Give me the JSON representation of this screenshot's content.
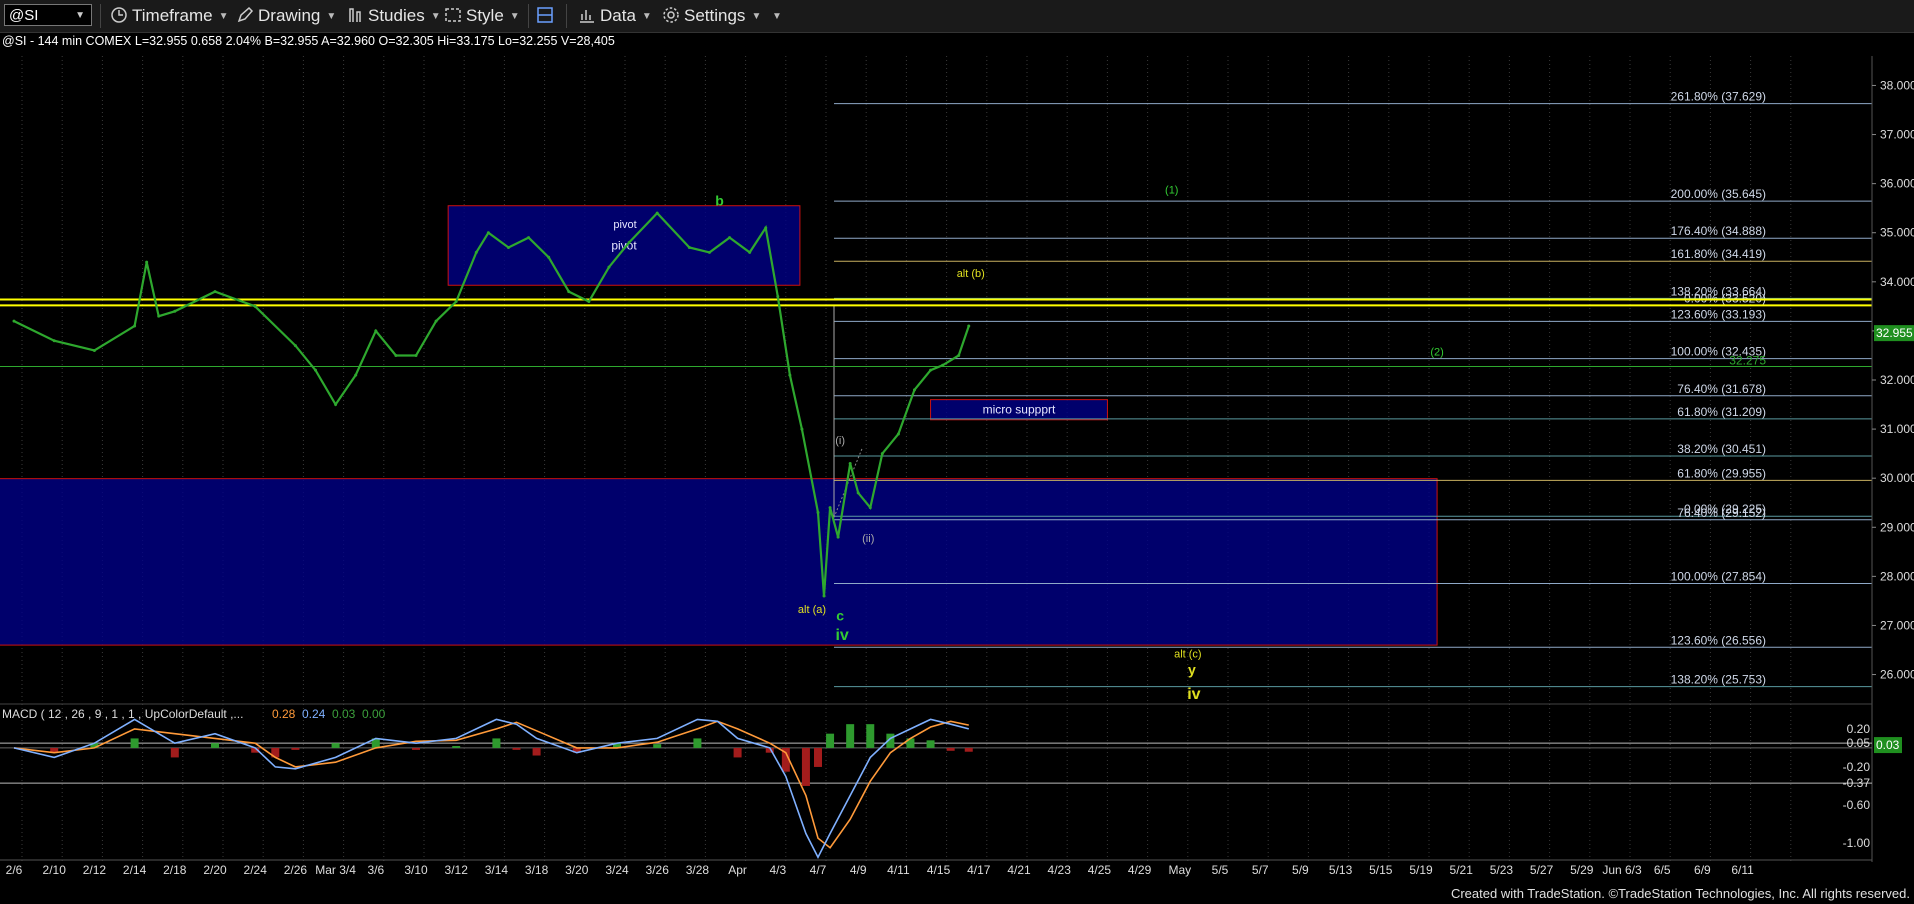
{
  "toolbar": {
    "symbol": "@SI",
    "timeframe": "Timeframe",
    "drawing": "Drawing",
    "studies": "Studies",
    "style": "Style",
    "data": "Data",
    "settings": "Settings"
  },
  "info_line": "@SI - 144 min  COMEX  L=32.955  0.658  2.04%  B=32.955  A=32.960  O=32.305  Hi=33.175  Lo=32.255  V=28,405",
  "footer": "Created with TradeStation. ©TradeStation Technologies, Inc. All rights reserved.",
  "colors": {
    "background": "#000000",
    "price": "#2ea82e",
    "box_fill": "#00008b",
    "box_border": "#cc1111",
    "yellow_line": "#ffff00",
    "wave_green": "#33cc33",
    "wave_yellow": "#e0e020",
    "macd_line": "#7fb0ff",
    "signal_line": "#ff9a3a"
  },
  "chart_data": {
    "type": "line",
    "x_ticks": [
      "2/6",
      "2/10",
      "2/12",
      "2/14",
      "2/18",
      "2/20",
      "2/24",
      "2/26",
      "Mar 3/4",
      "3/6",
      "3/10",
      "3/12",
      "3/14",
      "3/18",
      "3/20",
      "3/24",
      "3/26",
      "3/28",
      "Apr",
      "4/3",
      "4/7",
      "4/9",
      "4/11",
      "4/15",
      "4/17",
      "4/21",
      "4/23",
      "4/25",
      "4/29",
      "May",
      "5/5",
      "5/7",
      "5/9",
      "5/13",
      "5/15",
      "5/19",
      "5/21",
      "5/23",
      "5/27",
      "5/29",
      "Jun 6/3",
      "6/5",
      "6/9",
      "6/11"
    ],
    "y_ticks": [
      26,
      27,
      28,
      29,
      30,
      31,
      32,
      33,
      34,
      35,
      36,
      37,
      38
    ],
    "y_tick_labels": [
      "26.000",
      "27.000",
      "28.000",
      "29.000",
      "30.000",
      "31.000",
      "32.000",
      "33.000",
      "34.000",
      "35.000",
      "36.000",
      "37.000",
      "38.000"
    ],
    "ylim": [
      25.4,
      38.6
    ],
    "last_price": 32.955,
    "last_price_label": "32.955",
    "price_series": {
      "x": [
        0,
        1,
        2,
        3,
        3.3,
        3.6,
        4,
        5,
        6,
        7,
        7.5,
        8,
        8.5,
        9,
        9.5,
        10,
        10.5,
        11,
        11.5,
        11.8,
        12.3,
        12.8,
        13.3,
        13.8,
        14.3,
        14.8,
        15.3,
        16,
        16.8,
        17.3,
        17.8,
        18.3,
        18.7,
        19,
        19.3,
        19.6,
        20,
        20.15,
        20.3,
        20.5,
        20.8,
        21,
        21.3,
        21.6,
        22,
        22.4,
        22.8,
        23.1,
        23.5,
        23.75
      ],
      "y": [
        33.2,
        32.8,
        32.6,
        33.1,
        34.4,
        33.3,
        33.4,
        33.8,
        33.5,
        32.7,
        32.2,
        31.5,
        32.1,
        33.0,
        32.5,
        32.5,
        33.2,
        33.6,
        34.6,
        35.0,
        34.7,
        34.9,
        34.5,
        33.8,
        33.6,
        34.3,
        34.8,
        35.4,
        34.7,
        34.6,
        34.9,
        34.6,
        35.1,
        33.7,
        32.1,
        31.0,
        29.3,
        27.6,
        29.4,
        28.8,
        30.3,
        29.7,
        29.4,
        30.5,
        30.9,
        31.8,
        32.2,
        32.3,
        32.5,
        33.1
      ]
    },
    "boxes": [
      {
        "label": "pivot",
        "x0": 10.8,
        "x1": 19.55,
        "y0": 33.93,
        "y1": 35.55
      },
      {
        "label": "micro suppprt",
        "x0": 22.8,
        "x1": 27.2,
        "y0": 31.19,
        "y1": 31.6
      },
      {
        "label": "",
        "x0": -0.5,
        "x1": 35.4,
        "y0": 26.6,
        "y1": 29.99
      }
    ],
    "yellow_levels": [
      33.64,
      33.52
    ],
    "fib_levels": [
      {
        "label": "261.80% (37.629)",
        "value": 37.629,
        "color": "#8fa9c8"
      },
      {
        "label": "200.00% (35.645)",
        "value": 35.645,
        "color": "#8fa9c8"
      },
      {
        "label": "176.40% (34.888)",
        "value": 34.888,
        "color": "#8fa9c8"
      },
      {
        "label": "161.80% (34.419)",
        "value": 34.419,
        "color": "#c8b060"
      },
      {
        "label": "138.20% (33.664)",
        "value": 33.664,
        "color": "#5a9aa0"
      },
      {
        "label": "0.00% (33.520)",
        "value": 33.52,
        "color": "#5a9aa0"
      },
      {
        "label": "123.60% (33.193)",
        "value": 33.193,
        "color": "#8fa9c8"
      },
      {
        "label": "100.00% (32.435)",
        "value": 32.435,
        "color": "#8fa9c8"
      },
      {
        "label": "76.40% (31.678)",
        "value": 31.678,
        "color": "#8fa9c8"
      },
      {
        "label": "61.80% (31.209)",
        "value": 31.209,
        "color": "#5a9aa0"
      },
      {
        "label": "38.20% (30.451)",
        "value": 30.451,
        "color": "#5a9aa0"
      },
      {
        "label": "61.80% (29.955)",
        "value": 29.955,
        "color": "#c8b060"
      },
      {
        "label": "0.00% (29.225)",
        "value": 29.225,
        "color": "#5a9aa0"
      },
      {
        "label": "76.40% (29.152)",
        "value": 29.152,
        "color": "#8fa9c8"
      },
      {
        "label": "100.00% (27.854)",
        "value": 27.854,
        "color": "#8fa9c8"
      },
      {
        "label": "123.60% (26.556)",
        "value": 26.556,
        "color": "#8fa9c8"
      },
      {
        "label": "138.20% (25.753)",
        "value": 25.753,
        "color": "#5a9aa0"
      }
    ],
    "green_levels": [
      {
        "label": "32.275",
        "value": 32.275
      }
    ],
    "annotations": [
      {
        "text": "b",
        "x": 17.55,
        "y": 35.55,
        "color": "#33cc33",
        "size": 14
      },
      {
        "text": "pivot",
        "x": 15.2,
        "y": 35.1,
        "color": "#e6e6ff",
        "size": 11
      },
      {
        "text": "alt (b)",
        "x": 23.8,
        "y": 34.1,
        "color": "#e0e020",
        "size": 11
      },
      {
        "text": "(1)",
        "x": 28.8,
        "y": 35.8,
        "color": "#33cc33",
        "size": 11
      },
      {
        "text": "(2)",
        "x": 35.4,
        "y": 32.5,
        "color": "#33cc33",
        "size": 11
      },
      {
        "text": "(i)",
        "x": 20.55,
        "y": 30.7,
        "color": "#aaaaaa",
        "size": 11
      },
      {
        "text": "(ii)",
        "x": 21.25,
        "y": 28.7,
        "color": "#aaaaaa",
        "size": 11
      },
      {
        "text": "alt (a)",
        "x": 19.85,
        "y": 27.25,
        "color": "#e0e020",
        "size": 11
      },
      {
        "text": "c",
        "x": 20.55,
        "y": 27.1,
        "color": "#33cc33",
        "size": 14
      },
      {
        "text": "iv",
        "x": 20.6,
        "y": 26.7,
        "color": "#33cc33",
        "size": 16
      },
      {
        "text": "alt (c)",
        "x": 29.2,
        "y": 26.35,
        "color": "#e0e020",
        "size": 11
      },
      {
        "text": "y",
        "x": 29.3,
        "y": 26.0,
        "color": "#e0e020",
        "size": 14
      },
      {
        "text": "iv",
        "x": 29.35,
        "y": 25.5,
        "color": "#e0e020",
        "size": 16
      }
    ],
    "macd": {
      "title": "MACD ( 12 , 26 , 9 , 1 , 1 , UpColorDefault ,...",
      "values": [
        "0.28",
        "0.24",
        "0.03",
        "0.00"
      ],
      "ylim": [
        -1.2,
        0.42
      ],
      "y_tick_labels": [
        {
          "label": "0.20",
          "value": 0.2
        },
        {
          "label": "0.05",
          "value": 0.05
        },
        {
          "label": "-0.20",
          "value": -0.2
        },
        {
          "label": "-0.37",
          "value": -0.37
        },
        {
          "label": "-0.60",
          "value": -0.6
        },
        {
          "label": "-1.00",
          "value": -1.0
        }
      ],
      "last_label": "0.03",
      "x": [
        0,
        1,
        2,
        3,
        4,
        5,
        6,
        6.5,
        7,
        8,
        9,
        10,
        11,
        12,
        12.5,
        13,
        14,
        15,
        16,
        17,
        17.5,
        18,
        18.8,
        19.2,
        19.7,
        20,
        20.3,
        20.8,
        21.3,
        21.8,
        22.3,
        22.8,
        23.3,
        23.75
      ],
      "macd_line": [
        0.0,
        -0.1,
        0.05,
        0.3,
        0.05,
        0.15,
        0.0,
        -0.2,
        -0.22,
        -0.1,
        0.1,
        0.05,
        0.1,
        0.3,
        0.25,
        0.1,
        -0.05,
        0.05,
        0.1,
        0.3,
        0.28,
        0.1,
        0.0,
        -0.3,
        -0.9,
        -1.15,
        -0.9,
        -0.5,
        -0.1,
        0.1,
        0.2,
        0.3,
        0.25,
        0.2
      ],
      "signal_line": [
        0.0,
        -0.05,
        0.0,
        0.2,
        0.15,
        0.1,
        0.05,
        -0.1,
        -0.2,
        -0.15,
        0.0,
        0.07,
        0.08,
        0.2,
        0.27,
        0.18,
        0.0,
        0.0,
        0.06,
        0.2,
        0.28,
        0.2,
        0.05,
        -0.05,
        -0.5,
        -0.95,
        -1.05,
        -0.75,
        -0.35,
        -0.05,
        0.1,
        0.22,
        0.28,
        0.24
      ],
      "hist": [
        0.0,
        -0.05,
        0.05,
        0.1,
        -0.1,
        0.05,
        -0.05,
        -0.1,
        -0.02,
        0.05,
        0.1,
        -0.02,
        0.02,
        0.1,
        -0.02,
        -0.08,
        -0.05,
        0.05,
        0.04,
        0.1,
        0.0,
        -0.1,
        -0.05,
        -0.25,
        -0.4,
        -0.2,
        0.15,
        0.25,
        0.25,
        0.15,
        0.1,
        0.08,
        -0.03,
        -0.04
      ]
    }
  }
}
